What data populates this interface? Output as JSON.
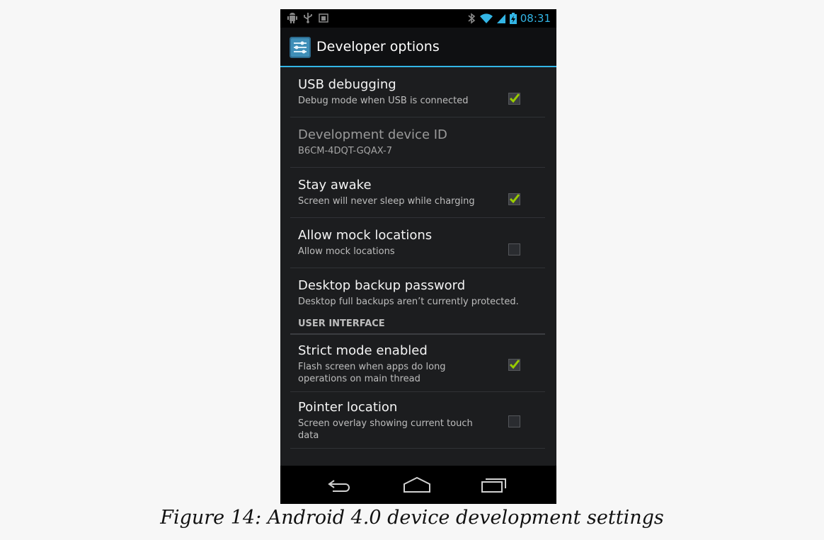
{
  "status_bar": {
    "time": "08:31",
    "left_icons": [
      "android-debug-icon",
      "usb-icon",
      "sd-card-icon"
    ],
    "right_icons": [
      "bluetooth-icon",
      "wifi-icon",
      "signal-icon",
      "battery-charging-icon"
    ]
  },
  "action_bar": {
    "title": "Developer options",
    "icon": "developer-settings-icon"
  },
  "items": [
    {
      "title": "USB debugging",
      "summary": "Debug mode when USB is connected",
      "checkbox": true,
      "checked": true,
      "enabled": true
    },
    {
      "title": "Development device ID",
      "summary": "B6CM-4DQT-GQAX-7",
      "checkbox": false,
      "checked": false,
      "enabled": false
    },
    {
      "title": "Stay awake",
      "summary": "Screen will never sleep while charging",
      "checkbox": true,
      "checked": true,
      "enabled": true
    },
    {
      "title": "Allow mock locations",
      "summary": "Allow mock locations",
      "checkbox": true,
      "checked": false,
      "enabled": true
    },
    {
      "title": "Desktop backup password",
      "summary": "Desktop full backups aren’t currently protected.",
      "checkbox": false,
      "checked": false,
      "enabled": true
    }
  ],
  "section": {
    "label": "USER INTERFACE"
  },
  "ui_items": [
    {
      "title": "Strict mode enabled",
      "summary": "Flash screen when apps do long operations on main thread",
      "checkbox": true,
      "checked": true,
      "enabled": true
    },
    {
      "title": "Pointer location",
      "summary": "Screen overlay showing current touch data",
      "checkbox": true,
      "checked": false,
      "enabled": true
    }
  ],
  "nav_bar": {
    "buttons": [
      "back-icon",
      "home-icon",
      "recent-apps-icon"
    ]
  },
  "caption": "Figure 14: Android 4.0 device development settings",
  "colors": {
    "accent": "#33b5e5",
    "check": "#99cc00",
    "background": "#1c1d1f"
  }
}
